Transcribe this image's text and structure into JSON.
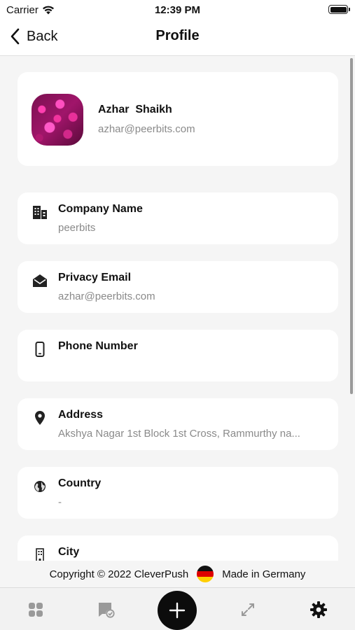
{
  "status_bar": {
    "carrier": "Carrier",
    "time": "12:39 PM"
  },
  "header": {
    "back_label": "Back",
    "title": "Profile"
  },
  "profile": {
    "name": "Azhar  Shaikh",
    "email": "azhar@peerbits.com"
  },
  "fields": [
    {
      "label": "Company Name",
      "value": "peerbits",
      "icon": "building-icon"
    },
    {
      "label": "Privacy Email",
      "value": "azhar@peerbits.com",
      "icon": "envelope-open-icon"
    },
    {
      "label": "Phone Number",
      "value": "",
      "icon": "phone-icon"
    },
    {
      "label": "Address",
      "value": "Akshya Nagar 1st Block 1st Cross, Rammurthy na...",
      "icon": "location-pin-icon"
    },
    {
      "label": "Country",
      "value": "-",
      "icon": "globe-icon"
    },
    {
      "label": "City",
      "value": "",
      "icon": "city-building-icon"
    }
  ],
  "footer": {
    "copyright": "Copyright © 2022 CleverPush",
    "made_in": "Made in Germany"
  },
  "tab_bar": {
    "items": [
      "grid-icon",
      "message-check-icon",
      "plus-icon",
      "arrows-exchange-icon",
      "gear-icon"
    ],
    "active": "gear-icon"
  },
  "colors": {
    "accent": "#0c0c0c",
    "muted_text": "#8a8a8a",
    "background": "#f5f5f5"
  }
}
